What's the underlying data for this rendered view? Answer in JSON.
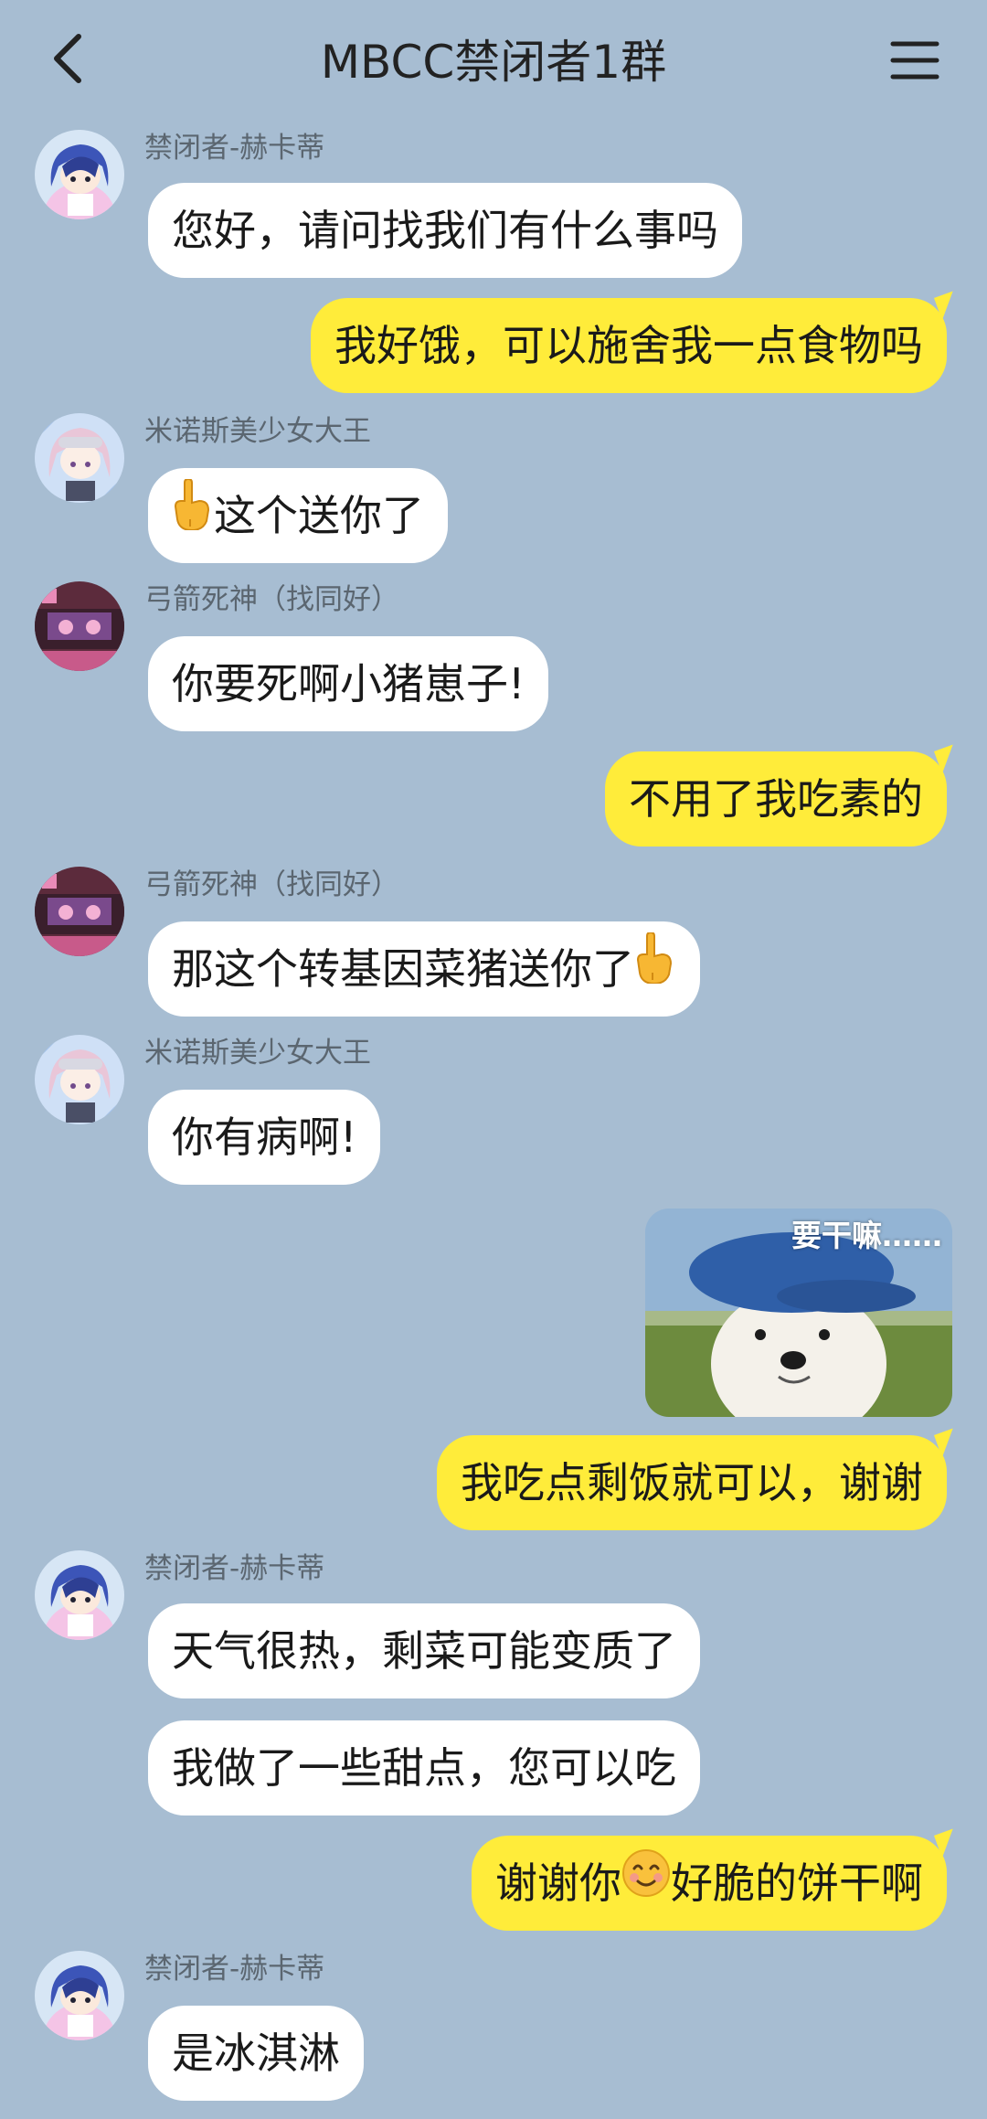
{
  "header": {
    "title": "MBCC禁闭者1群"
  },
  "colors": {
    "background": "#a7bdd2",
    "incoming_bubble": "#ffffff",
    "outgoing_bubble": "#ffec3a"
  },
  "senders": {
    "hecate": "禁闭者-赫卡蒂",
    "minos": "米诺斯美少女大王",
    "archer": "弓箭死神（找同好）"
  },
  "messages": {
    "m1": "您好，请问找我们有什么事吗",
    "m2": "我好饿，可以施舍我一点食物吗",
    "m3": "这个送你了",
    "m4": "你要死啊小猪崽子!",
    "m5": "不用了我吃素的",
    "m6": "那这个转基因菜猪送你了",
    "m7": "你有病啊!",
    "m8_sticker_caption": "要干嘛……",
    "m9": "我吃点剩饭就可以，谢谢",
    "m10": "天气很热，剩菜可能变质了",
    "m11": "我做了一些甜点，您可以吃",
    "m12_a": "谢谢你",
    "m12_b": "好脆的饼干啊",
    "m13": "是冰淇淋"
  },
  "icons": {
    "back": "chevron-left-icon",
    "menu": "hamburger-menu-icon",
    "pointing_down": "backhand-index-pointing-down-emoji",
    "smile": "smiling-face-emoji"
  }
}
